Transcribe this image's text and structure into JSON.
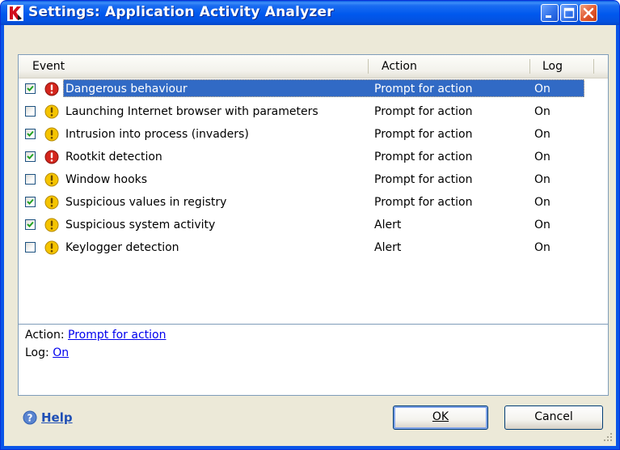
{
  "window": {
    "title": "Settings: Application Activity Analyzer",
    "accent": "#0058ee",
    "controls": {
      "minimize": "minimize-icon",
      "maximize": "maximize-icon",
      "close": "close-icon"
    }
  },
  "list": {
    "headers": {
      "event": "Event",
      "action": "Action",
      "log": "Log"
    },
    "selected_index": 0,
    "rows": [
      {
        "checked": true,
        "severity": "danger",
        "event": "Dangerous behaviour",
        "action": "Prompt for action",
        "log": "On"
      },
      {
        "checked": false,
        "severity": "warning",
        "event": "Launching Internet browser with parameters",
        "action": "Prompt for action",
        "log": "On"
      },
      {
        "checked": true,
        "severity": "warning",
        "event": "Intrusion into process (invaders)",
        "action": "Prompt for action",
        "log": "On"
      },
      {
        "checked": true,
        "severity": "danger",
        "event": "Rootkit detection",
        "action": "Prompt for action",
        "log": "On"
      },
      {
        "checked": false,
        "severity": "warning",
        "event": "Window hooks",
        "action": "Prompt for action",
        "log": "On"
      },
      {
        "checked": true,
        "severity": "warning",
        "event": "Suspicious values in registry",
        "action": "Prompt for action",
        "log": "On"
      },
      {
        "checked": true,
        "severity": "warning",
        "event": "Suspicious system activity",
        "action": "Alert",
        "log": "On"
      },
      {
        "checked": false,
        "severity": "warning",
        "event": "Keylogger detection",
        "action": "Alert",
        "log": "On"
      }
    ]
  },
  "detail": {
    "action_label": "Action:",
    "action_value": "Prompt for action",
    "log_label": "Log:",
    "log_value": "On"
  },
  "footer": {
    "help": "Help",
    "ok": "OK",
    "cancel": "Cancel"
  },
  "colors": {
    "danger": "#d4261d",
    "warning": "#f5c400",
    "selection": "#316ac5"
  }
}
